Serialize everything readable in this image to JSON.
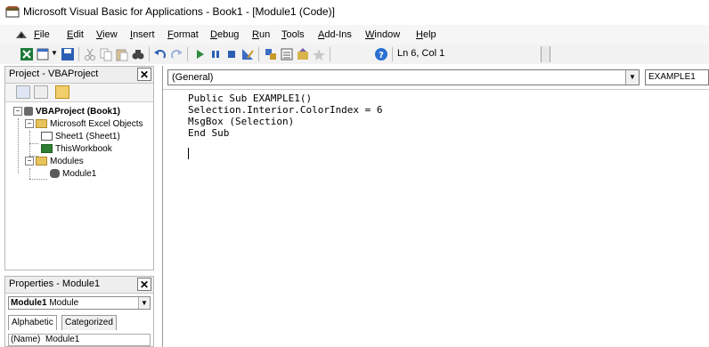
{
  "window": {
    "title": "Microsoft Visual Basic for Applications - Book1 - [Module1 (Code)]"
  },
  "menu": {
    "items": [
      "File",
      "Edit",
      "View",
      "Insert",
      "Format",
      "Debug",
      "Run",
      "Tools",
      "Add-Ins",
      "Window",
      "Help"
    ]
  },
  "toolbar": {
    "cursor_position": "Ln 6, Col 1",
    "icons": [
      "excel-view-icon",
      "insert-module-icon",
      "save-icon",
      "cut-icon",
      "copy-icon",
      "paste-icon",
      "find-icon",
      "undo-icon",
      "redo-icon",
      "run-icon",
      "break-icon",
      "reset-icon",
      "design-mode-icon",
      "project-explorer-icon",
      "properties-icon",
      "object-browser-icon",
      "toolbox-icon",
      "help-icon"
    ]
  },
  "project_panel": {
    "title": "Project - VBAProject",
    "close": "✕",
    "tree": {
      "root": "VBAProject (Book1)",
      "excel_objects": "Microsoft Excel Objects",
      "sheet1": "Sheet1 (Sheet1)",
      "thisworkbook": "ThisWorkbook",
      "modules": "Modules",
      "module1": "Module1"
    }
  },
  "properties_panel": {
    "title": "Properties - Module1",
    "close": "✕",
    "object_name": "Module1",
    "object_type": "Module",
    "tabs": [
      "Alphabetic",
      "Categorized"
    ],
    "row": {
      "name": "(Name)",
      "value": "Module1"
    }
  },
  "code_window": {
    "object_combo": "(General)",
    "procedure_combo": "EXAMPLE1",
    "lines": [
      "Public Sub EXAMPLE1()",
      "Selection.Interior.ColorIndex = 6",
      "MsgBox (Selection)",
      "End Sub"
    ]
  },
  "colors": {
    "menu_bg": "#f6f6f6",
    "toolbar_bg": "#f2f2f2",
    "panel_title_bg": "#eeeeee"
  }
}
